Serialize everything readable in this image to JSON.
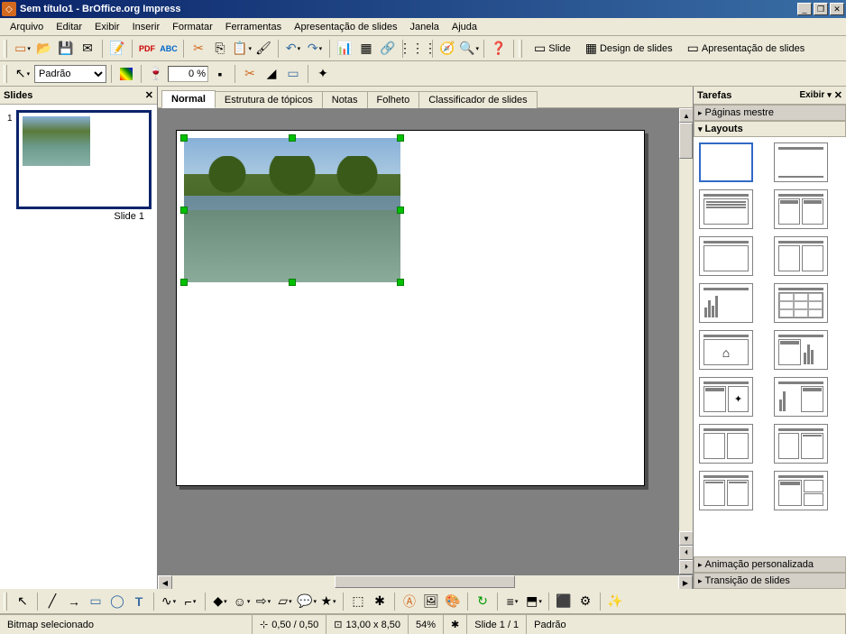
{
  "titlebar": {
    "title": "Sem título1 - BrOffice.org Impress"
  },
  "menubar": [
    "Arquivo",
    "Editar",
    "Exibir",
    "Inserir",
    "Formatar",
    "Ferramentas",
    "Apresentação de slides",
    "Janela",
    "Ajuda"
  ],
  "toolbar2": {
    "style_combo": "Padrão",
    "zoom_value": "0 %"
  },
  "toolbar_right": {
    "slide": "Slide",
    "design": "Design de slides",
    "presentation": "Apresentação de slides"
  },
  "slidepanel": {
    "title": "Slides",
    "slide_label": "Slide 1",
    "slide_num": "1"
  },
  "viewtabs": [
    "Normal",
    "Estrutura de tópicos",
    "Notas",
    "Folheto",
    "Classificador de slides"
  ],
  "taskpanel": {
    "title": "Tarefas",
    "view_label": "Exibir",
    "sections": {
      "master": "Páginas mestre",
      "layouts": "Layouts",
      "anim": "Animação personalizada",
      "transition": "Transição de slides"
    }
  },
  "statusbar": {
    "selection": "Bitmap selecionado",
    "pos": "0,50 / 0,50",
    "size": "13,00 x 8,50",
    "zoom": "54%",
    "slide": "Slide 1 / 1",
    "template": "Padrão"
  }
}
